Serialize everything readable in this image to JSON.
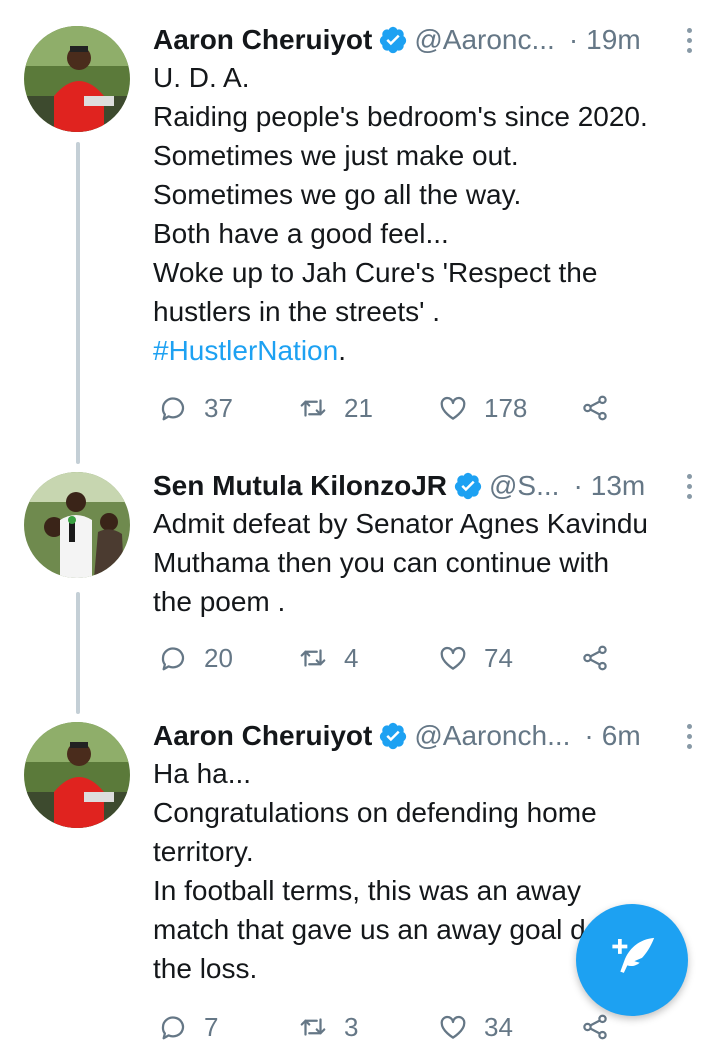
{
  "tweets": [
    {
      "name": "Aaron Cheruiyot",
      "handle": "@Aaronc...",
      "separator": "·",
      "time": "19m",
      "lines": [
        "U. D. A.",
        "Raiding people's bedroom's since 2020.",
        "Sometimes we just make out.",
        "Sometimes we go all the way.",
        "Both have a good feel...",
        "Woke up to Jah Cure's 'Respect the",
        "hustlers in the streets' ."
      ],
      "hashtag": "#HustlerNation",
      "hashtag_suffix": ".",
      "replies": "37",
      "retweets": "21",
      "likes": "178"
    },
    {
      "name": "Sen Mutula KilonzoJR",
      "handle": "@S...",
      "separator": "·",
      "time": "13m",
      "lines": [
        "Admit defeat by Senator Agnes Kavindu",
        "Muthama  then you can continue with",
        "the poem ."
      ],
      "replies": "20",
      "retweets": "4",
      "likes": "74"
    },
    {
      "name": "Aaron Cheruiyot",
      "handle": "@Aaronch...",
      "separator": "·",
      "time": "6m",
      "lines": [
        "Ha ha...",
        "Congratulations on defending home",
        "territory.",
        "In football terms, this was an away",
        "match that gave us an away goal despite",
        "the loss."
      ],
      "replies": "7",
      "retweets": "3",
      "likes": "34"
    }
  ],
  "icons": {
    "verified": "verified-badge-icon",
    "reply": "reply-icon",
    "retweet": "retweet-icon",
    "like": "heart-icon",
    "share": "share-icon",
    "more": "more-vertical-icon",
    "compose": "compose-tweet-icon"
  },
  "colors": {
    "accent": "#1da1f2",
    "secondary_text": "#657786",
    "thread_line": "#c4cfd6"
  }
}
